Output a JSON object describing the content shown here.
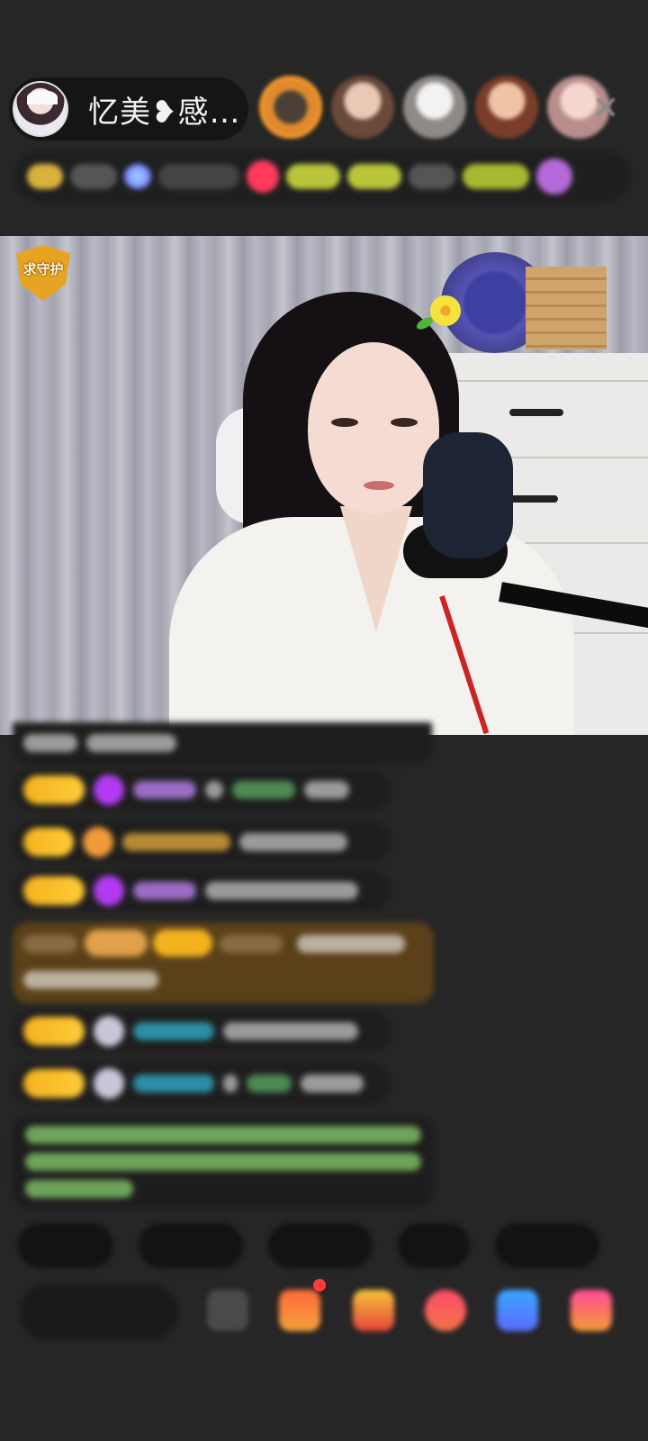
{
  "host": {
    "name": "忆美❥感…"
  },
  "video": {
    "guard_badge_label": "求守护"
  }
}
